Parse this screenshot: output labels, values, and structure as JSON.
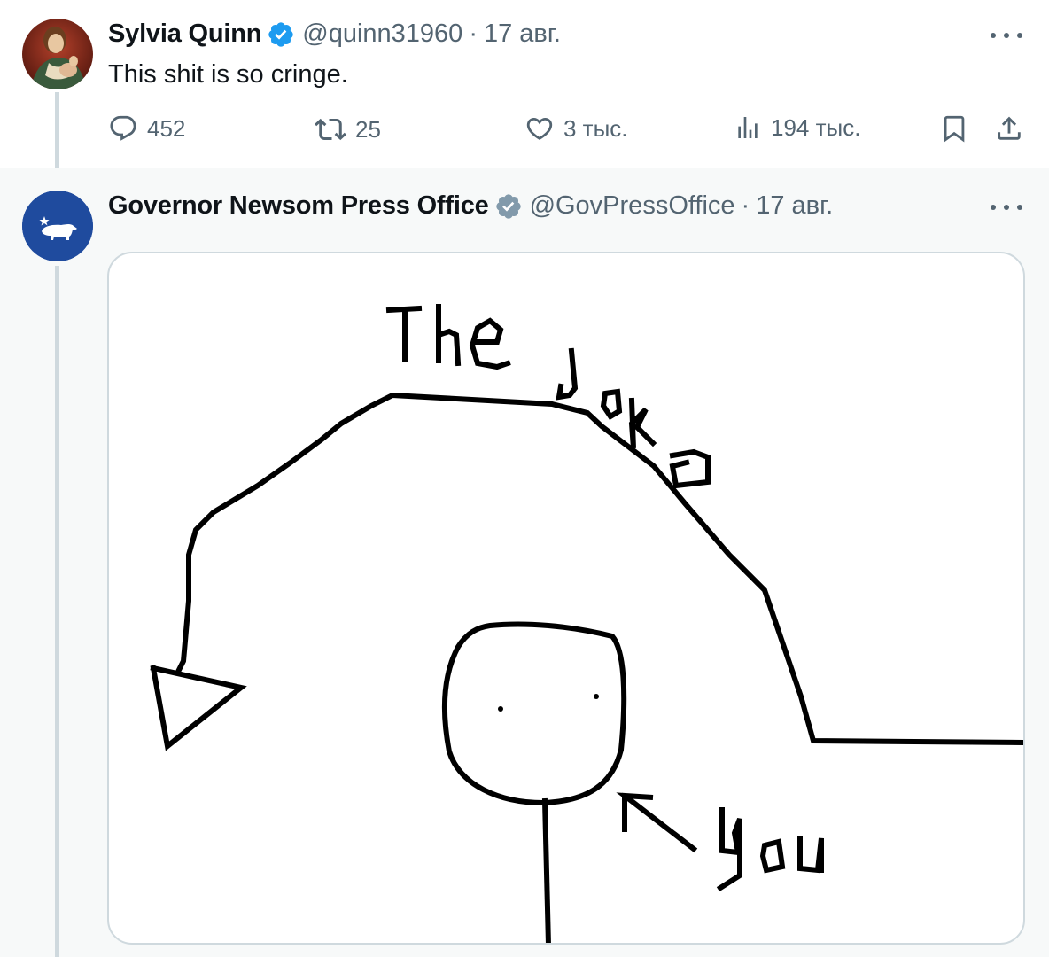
{
  "tweets": [
    {
      "author": {
        "name": "Sylvia Quinn",
        "handle": "@quinn31960",
        "verified": true,
        "avatar_icon": "renaissance-portrait-avatar"
      },
      "separator": "·",
      "date": "17 авг.",
      "text": "This shit is so cringe.",
      "stats": {
        "replies": "452",
        "reposts": "25",
        "likes": "3 тыс.",
        "views": "194 тыс."
      }
    },
    {
      "author": {
        "name": "Governor Newsom Press Office",
        "handle": "@GovPressOffice",
        "verified": true,
        "badge_color": "#829aab",
        "avatar_icon": "california-bear-star-avatar",
        "avatar_color": "#1f4b9e"
      },
      "separator": "·",
      "date": "17 авг.",
      "media": {
        "type": "hand-drawn-meme",
        "labels": {
          "the": "The",
          "joke": "Joke",
          "you": "You"
        }
      }
    }
  ],
  "colors": {
    "verified_blue": "#1d9bf0",
    "secondary_text": "#536471",
    "border": "#cfd9de",
    "thread_line": "#cfd9de"
  }
}
